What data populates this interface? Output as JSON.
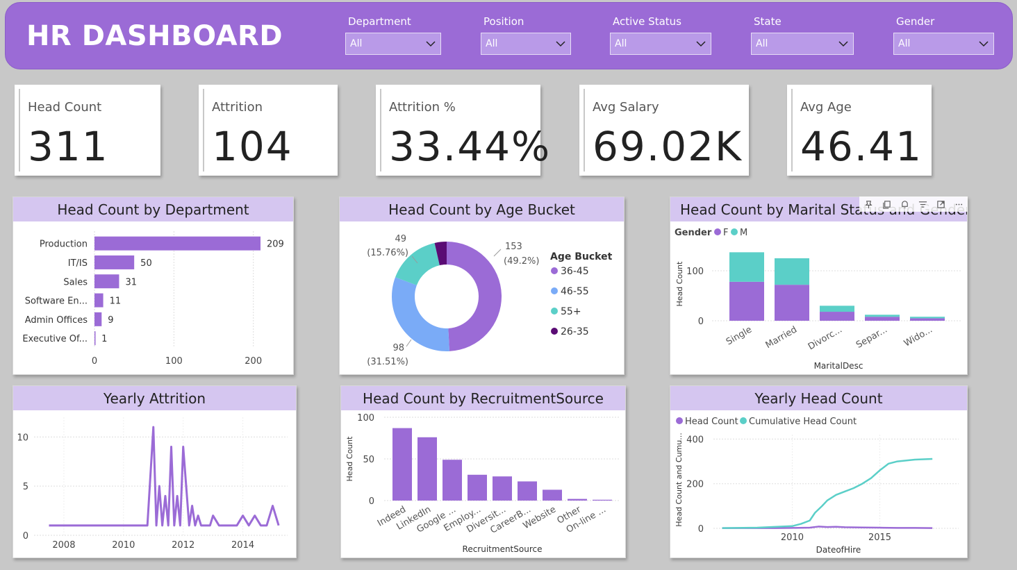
{
  "header": {
    "title": "HR DASHBOARD",
    "slicers": [
      {
        "label": "Department",
        "value": "All"
      },
      {
        "label": "Position",
        "value": "All"
      },
      {
        "label": "Active Status",
        "value": "All"
      },
      {
        "label": "State",
        "value": "All"
      },
      {
        "label": "Gender",
        "value": "All"
      }
    ]
  },
  "cards": [
    {
      "label": "Head Count",
      "value": "311"
    },
    {
      "label": "Attrition",
      "value": "104"
    },
    {
      "label": "Attrition %",
      "value": "33.44%"
    },
    {
      "label": "Avg Salary",
      "value": "69.02K"
    },
    {
      "label": "Avg Age",
      "value": "46.41"
    }
  ],
  "colors": {
    "purple": "#9b6bd6",
    "teal": "#5bcfc8",
    "blue": "#7aabf7",
    "dark_purple": "#5a0b74",
    "title_bg": "#d5c6f0"
  },
  "toolbar_icons": [
    "pin-icon",
    "copy-icon",
    "bell-icon",
    "filter-icon",
    "focus-icon",
    "more-icon"
  ],
  "chart_data": [
    {
      "id": "dept",
      "type": "bar",
      "orientation": "horizontal",
      "title": "Head Count by Department",
      "categories": [
        "Production",
        "IT/IS",
        "Sales",
        "Software En...",
        "Admin Offices",
        "Executive Of..."
      ],
      "values": [
        209,
        50,
        31,
        11,
        9,
        1
      ],
      "xticks": [
        0,
        100,
        200
      ],
      "xlim": [
        0,
        230
      ]
    },
    {
      "id": "age",
      "type": "pie",
      "title": "Head Count by Age Bucket",
      "legend_title": "Age Bucket",
      "slices": [
        {
          "label": "36-45",
          "value": 153,
          "pct": "(49.2%)"
        },
        {
          "label": "46-55",
          "value": 98,
          "pct": "(31.51%)"
        },
        {
          "label": "55+",
          "value": 49,
          "pct": "(15.76%)"
        },
        {
          "label": "26-35",
          "value": 11,
          "pct": ""
        }
      ]
    },
    {
      "id": "marital",
      "type": "bar",
      "stacked": true,
      "title": "Head Count by Marital Status and Gender",
      "legend_title": "Gender",
      "categories": [
        "Single",
        "Married",
        "Divorc...",
        "Separ...",
        "Wido..."
      ],
      "series": [
        {
          "name": "F",
          "values": [
            78,
            72,
            18,
            8,
            5
          ]
        },
        {
          "name": "M",
          "values": [
            59,
            53,
            12,
            4,
            3
          ]
        }
      ],
      "xlabel": "MaritalDesc",
      "ylabel": "Head Count",
      "yticks": [
        0,
        100
      ],
      "ylim": [
        0,
        150
      ]
    },
    {
      "id": "attrition",
      "type": "line",
      "title": "Yearly Attrition",
      "x": [
        2007.5,
        2008,
        2009,
        2010,
        2010.8,
        2011.0,
        2011.1,
        2011.2,
        2011.3,
        2011.4,
        2011.5,
        2011.6,
        2011.7,
        2011.8,
        2011.9,
        2012.0,
        2012.1,
        2012.2,
        2012.3,
        2012.4,
        2012.5,
        2012.6,
        2012.7,
        2012.8,
        2012.9,
        2013.0,
        2013.2,
        2013.4,
        2013.6,
        2013.8,
        2014.0,
        2014.2,
        2014.4,
        2014.6,
        2014.8,
        2015.0,
        2015.2
      ],
      "y": [
        1,
        1,
        1,
        1,
        1,
        11,
        1,
        5,
        1,
        4,
        1,
        9,
        1,
        4,
        1,
        9,
        5,
        1,
        3,
        1,
        2,
        1,
        1,
        1,
        1,
        2,
        1,
        1,
        1,
        1,
        2,
        1,
        2,
        1,
        1,
        3,
        1
      ],
      "xticks": [
        2008,
        2010,
        2012,
        2014
      ],
      "yticks": [
        0,
        5,
        10
      ],
      "xlim": [
        2007,
        2015.5
      ],
      "ylim": [
        0,
        12
      ]
    },
    {
      "id": "recruit",
      "type": "bar",
      "title": "Head Count by RecruitmentSource",
      "categories": [
        "Indeed",
        "LinkedIn",
        "Google ...",
        "Employ...",
        "Diversit...",
        "CareerB...",
        "Website",
        "Other",
        "On-line ..."
      ],
      "values": [
        87,
        76,
        49,
        31,
        29,
        23,
        13,
        2,
        1
      ],
      "xlabel": "RecruitmentSource",
      "ylabel": "Head Count",
      "yticks": [
        0,
        50,
        100
      ],
      "ylim": [
        0,
        100
      ]
    },
    {
      "id": "yearly",
      "type": "line",
      "title": "Yearly Head Count",
      "xlabel": "DateofHire",
      "ylabel": "Head Count and Cumu...",
      "series": [
        {
          "name": "Head Count",
          "x": [
            2006,
            2008,
            2009,
            2010,
            2011,
            2011.5,
            2012,
            2012.5,
            2013,
            2014,
            2015,
            2016,
            2017,
            2018
          ],
          "y": [
            1,
            1,
            1,
            2,
            3,
            8,
            6,
            7,
            5,
            4,
            3,
            2,
            2,
            1
          ]
        },
        {
          "name": "Cumulative Head Count",
          "x": [
            2006,
            2008,
            2010,
            2010.5,
            2011,
            2011.3,
            2011.7,
            2012,
            2012.5,
            2013,
            2013.5,
            2014,
            2014.5,
            2015,
            2015.5,
            2016,
            2017,
            2018
          ],
          "y": [
            1,
            3,
            10,
            20,
            35,
            70,
            100,
            125,
            150,
            165,
            180,
            200,
            225,
            260,
            290,
            300,
            308,
            311
          ]
        }
      ],
      "xticks": [
        2010,
        2015
      ],
      "yticks": [
        0,
        200,
        400
      ],
      "xlim": [
        2005.5,
        2019.5
      ],
      "ylim": [
        0,
        420
      ]
    }
  ]
}
